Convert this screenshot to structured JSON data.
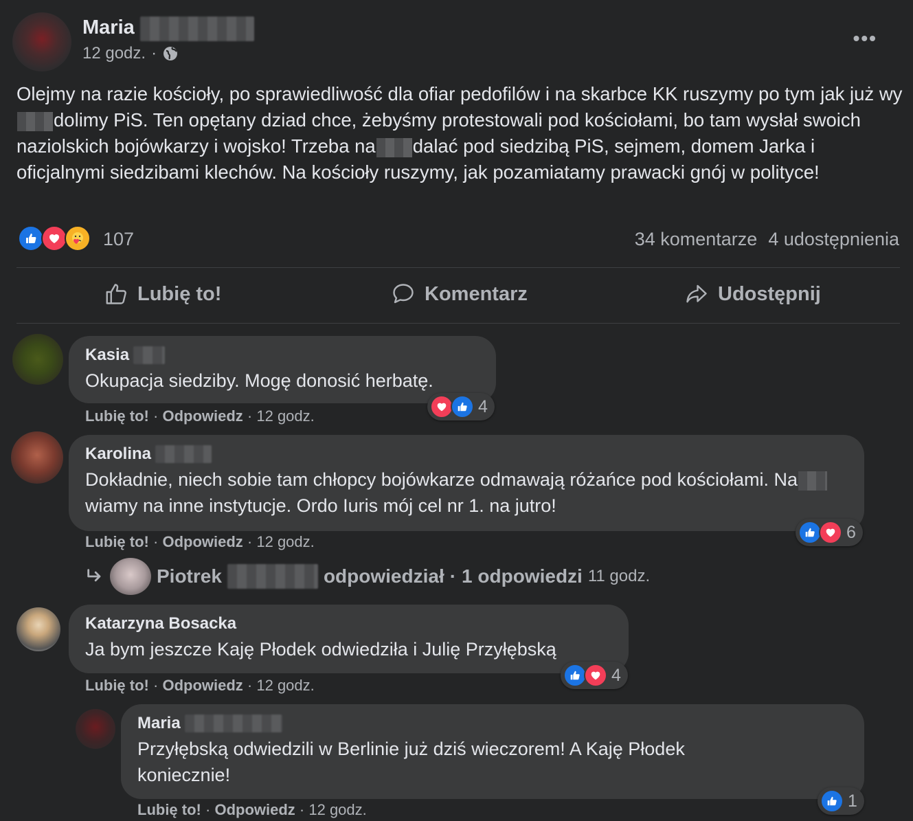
{
  "post": {
    "author": "Maria",
    "time": "12 godz.",
    "separator": "·",
    "text_parts": [
      "Olejmy na razie kościoły, po sprawiedliwość dla ofiar pedofilów i na skarbce KK ruszymy po tym jak już wy",
      "dolimy PiS. Ten opętany dziad chce, żebyśmy protestowali pod kościołami, bo tam wysłał swoich naziolskich bojówkarzy i wojsko! Trzeba na",
      "dalać pod siedzibą PiS, sejmem, domem Jarka i oficjalnymi siedzibami klechów. Na kościoły ruszymy, jak pozamiatamy prawacki gnój w polityce!"
    ],
    "reaction_count": "107",
    "comments_count": "34 komentarze",
    "shares_count": "4 udostępnienia"
  },
  "actions": {
    "like": "Lubię to!",
    "comment": "Komentarz",
    "share": "Udostępnij"
  },
  "comment_actions": {
    "like": "Lubię to!",
    "reply": "Odpowiedz",
    "sep": "·"
  },
  "comments": [
    {
      "name": "Kasia",
      "text": "Okupacja siedziby. Mogę donosić herbatę.",
      "time": "12 godz.",
      "reaction_count": "4"
    },
    {
      "name": "Karolina",
      "text": "Dokładnie, niech sobie tam chłopcy bojówkarze odmawają różańce pod kościołami. Na",
      "text2": "wiamy na inne instytucje. Ordo Iuris mój cel nr 1. na jutro!",
      "time": "12 godz.",
      "reaction_count": "6"
    },
    {
      "name": "Katarzyna Bosacka",
      "text": "Ja bym jeszcze Kaję Płodek odwiedziła i Julię Przyłębską",
      "time": "12 godz.",
      "reaction_count": "4"
    },
    {
      "name": "Maria",
      "text": "Przyłębską odwiedzili w Berlinie już dziś wieczorem! A Kaję Płodek koniecznie!",
      "time": "12 godz.",
      "reaction_count": "1"
    }
  ],
  "reply_summary": {
    "name": "Piotrek",
    "verb": "odpowiedział",
    "sep": "·",
    "count": "1 odpowiedzi",
    "time": "11 godz."
  },
  "colors": {
    "background": "#242526",
    "bubble": "#3a3b3c",
    "like": "#1b74e4",
    "love": "#f33e58"
  }
}
